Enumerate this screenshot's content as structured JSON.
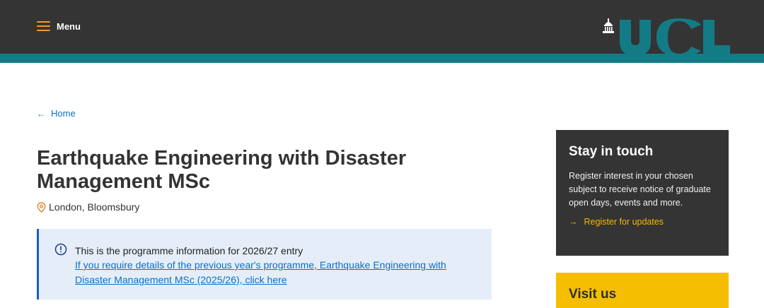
{
  "header": {
    "menu_label": "Menu",
    "logo_text": "UCL",
    "colors": {
      "bar": "#343434",
      "stripe": "#137b86",
      "menu_icon": "#f09a2b",
      "logo": "#137b86"
    }
  },
  "breadcrumb": {
    "icon": "arrow-left-icon",
    "label": "Home"
  },
  "page": {
    "title": "Earthquake Engineering with Disaster Management MSc",
    "location_icon": "map-pin-icon",
    "location": "London, Bloomsbury"
  },
  "notice": {
    "icon": "info-circle-icon",
    "text": "This is the programme information for 2026/27 entry",
    "link": "If you require details of the previous year's programme, Earthquake Engineering with Disaster Management MSc (2025/26), click here"
  },
  "stay_in_touch": {
    "title": "Stay in touch",
    "body": "Register interest in your chosen subject to receive notice of graduate open days, events and more.",
    "link_icon": "arrow-right-icon",
    "link": "Register for updates"
  },
  "visit_us": {
    "title": "Visit us"
  }
}
